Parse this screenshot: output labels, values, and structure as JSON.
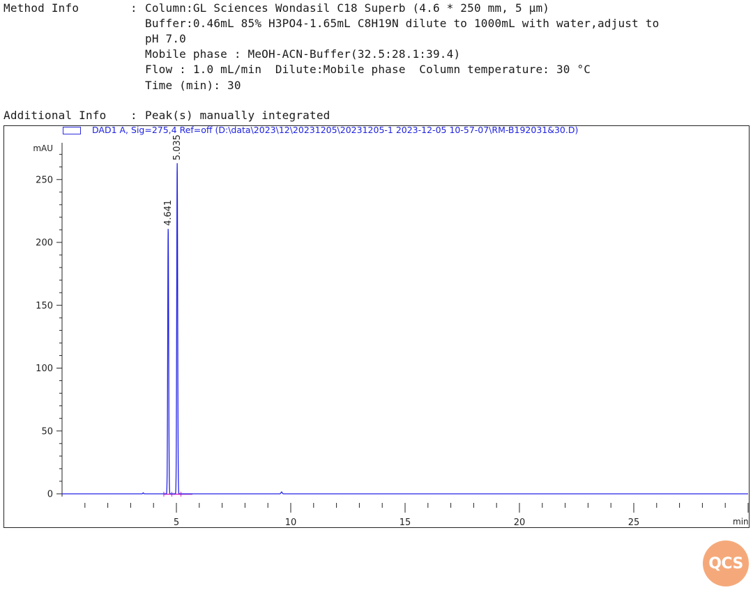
{
  "method": {
    "label": "Method Info",
    "sep": ":",
    "lines": [
      "Column:GL Sciences Wondasil C18 Superb (4.6 * 250 mm, 5 µm)",
      "Buffer:0.46mL 85% H3PO4-1.65mL C8H19N dilute to 1000mL with water,adjust to",
      "pH 7.0",
      "Mobile phase : MeOH-ACN-Buffer(32.5:28.1:39.4)",
      "Flow : 1.0 mL/min  Dilute:Mobile phase  Column temperature: 30 °C",
      "Time (min): 30"
    ]
  },
  "additional": {
    "label": "Additional Info",
    "sep": ":",
    "value": "Peak(s) manually integrated"
  },
  "logo_text": "QCS",
  "colors": {
    "trace": "#2323e6",
    "baseline": "#e020c0",
    "logo": "#f5a97a"
  },
  "chart_data": {
    "type": "line",
    "legend": "DAD1 A, Sig=275,4 Ref=off (D:\\data\\2023\\12\\20231205\\20231205-1 2023-12-05 10-57-07\\RM-B192031&30.D)",
    "ylabel": "mAU",
    "xlabel": "min",
    "xlim": [
      0,
      30
    ],
    "ylim": [
      -10,
      280
    ],
    "x_ticks": [
      5,
      10,
      15,
      20,
      25
    ],
    "y_ticks": [
      0,
      50,
      100,
      150,
      200,
      250
    ],
    "peaks": [
      {
        "rt": 4.641,
        "label": "4.641",
        "height": 211,
        "width": 0.09
      },
      {
        "rt": 5.035,
        "label": "5.035",
        "height": 263,
        "width": 0.09
      },
      {
        "rt": 3.55,
        "label": "",
        "height": 0.8,
        "width": 0.08
      },
      {
        "rt": 9.6,
        "label": "",
        "height": 1.5,
        "width": 0.12
      }
    ]
  }
}
